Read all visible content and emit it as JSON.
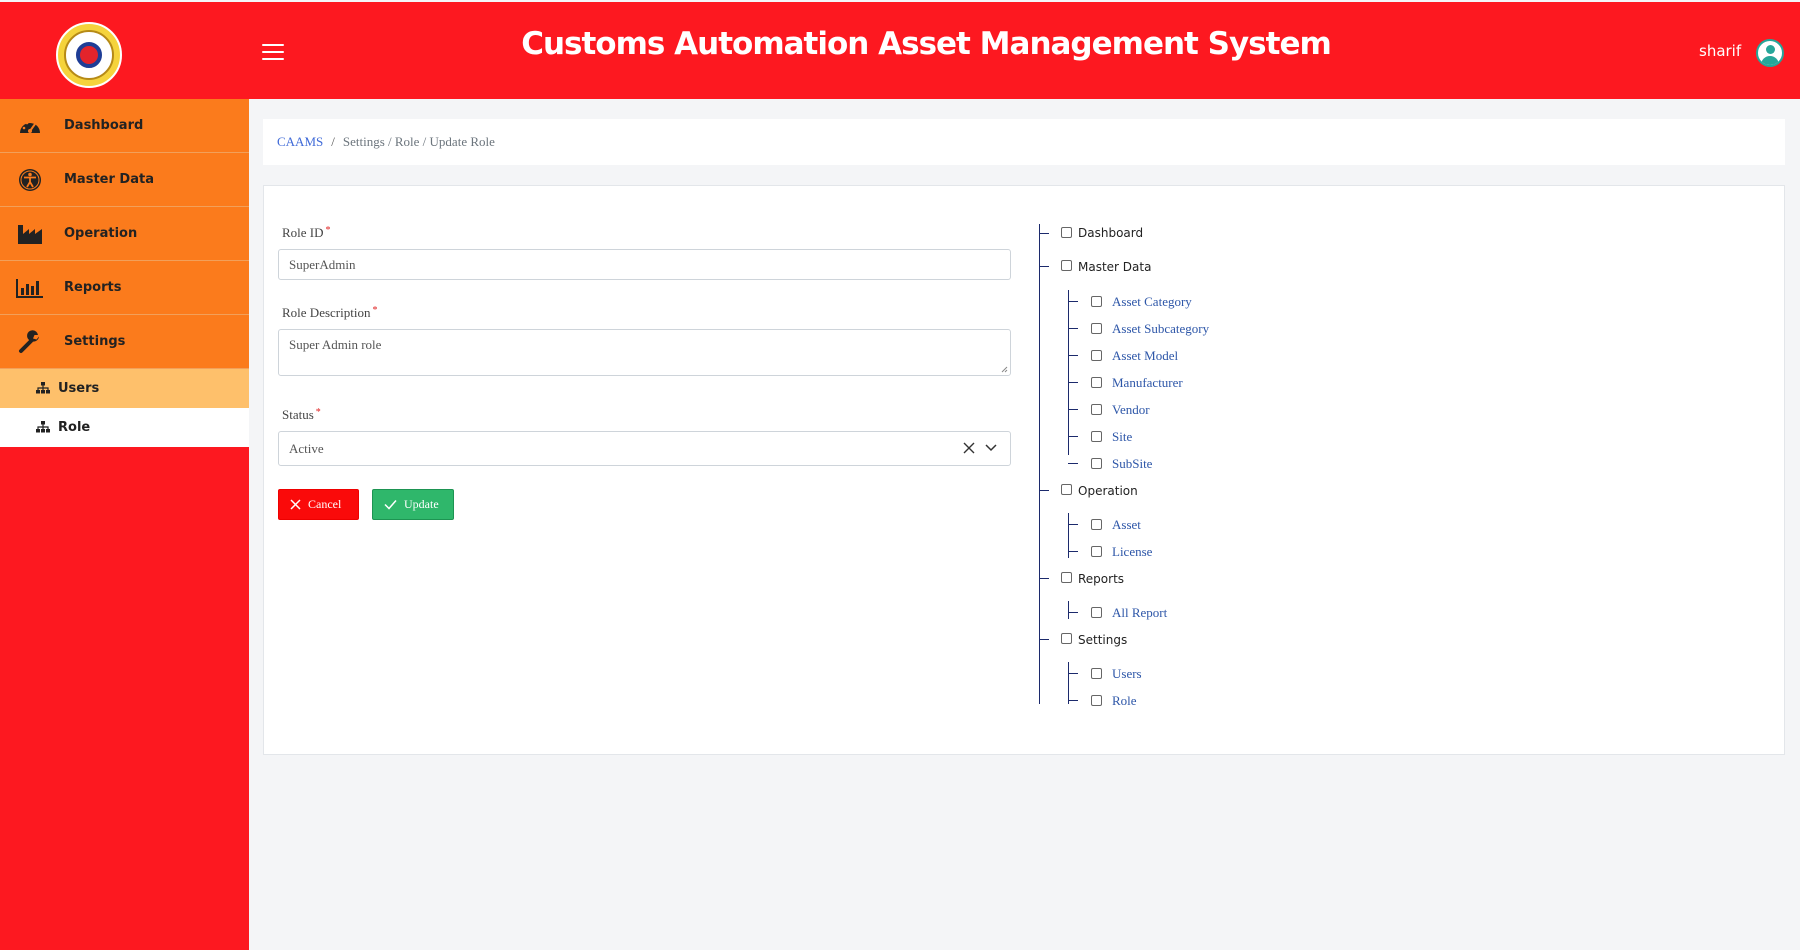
{
  "header": {
    "title": "Customs Automation Asset Management System",
    "user_name": "sharif"
  },
  "sidebar": {
    "items": [
      {
        "label": "Dashboard"
      },
      {
        "label": "Master Data"
      },
      {
        "label": "Operation"
      },
      {
        "label": "Reports"
      },
      {
        "label": "Settings"
      }
    ],
    "sub_items": [
      {
        "label": "Users"
      },
      {
        "label": "Role"
      }
    ],
    "active_sub": "Role"
  },
  "breadcrumb": {
    "home": "CAAMS",
    "sep": "/",
    "path": "Settings / Role / Update Role"
  },
  "form": {
    "role_id_label": "Role ID",
    "role_id_value": "SuperAdmin",
    "desc_label": "Role Description",
    "desc_value": "Super Admin role",
    "status_label": "Status",
    "status_value": "Active",
    "required_mark": "*",
    "cancel_label": "Cancel",
    "update_label": "Update"
  },
  "permissions": {
    "groups": [
      {
        "label": "Dashboard",
        "children": []
      },
      {
        "label": "Master Data",
        "children": [
          "Asset Category",
          "Asset Subcategory",
          "Asset Model",
          "Manufacturer",
          "Vendor",
          "Site",
          "SubSite"
        ]
      },
      {
        "label": "Operation",
        "children": [
          "Asset",
          "License"
        ]
      },
      {
        "label": "Reports",
        "children": [
          "All Report"
        ]
      },
      {
        "label": "Settings",
        "children": [
          "Users",
          "Role"
        ]
      }
    ]
  },
  "colors": {
    "header_bg": "#fd1820",
    "menu_bg": "#fb7b1c",
    "submenu_active_bg": "#fec06b",
    "link": "#3f6ad8",
    "cancel": "#fa0a0a",
    "update": "#2fb76b"
  }
}
